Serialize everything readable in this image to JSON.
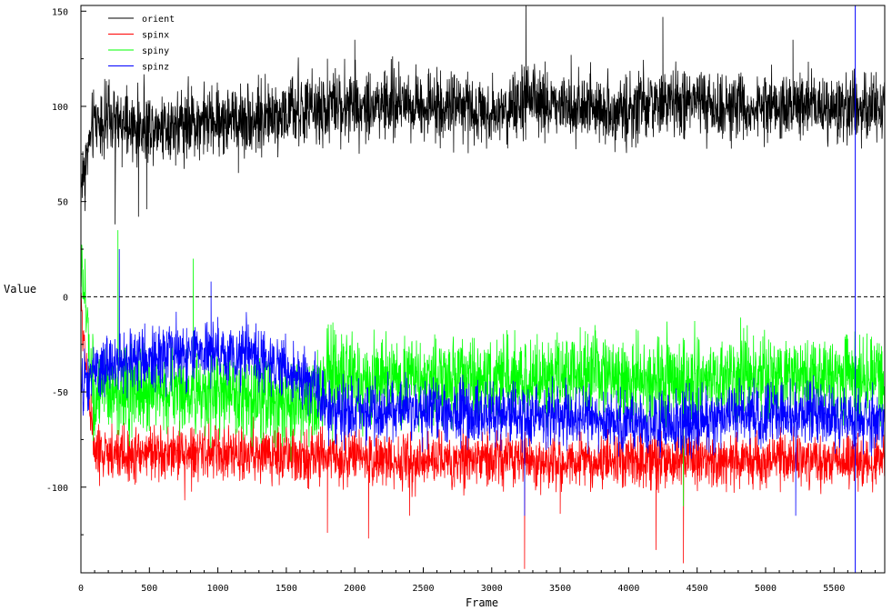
{
  "chart_data": {
    "type": "line",
    "xlabel": "Frame",
    "ylabel": "Value",
    "xlim": [
      0,
      5870
    ],
    "ylim": [
      -145,
      153
    ],
    "x_ticks": [
      0,
      500,
      1000,
      1500,
      2000,
      2500,
      3000,
      3500,
      4000,
      4500,
      5000,
      5500
    ],
    "x_tick_labels": [
      "0",
      "500",
      "1000",
      "1500",
      "2000",
      "2500",
      "3000",
      "3500",
      "4000",
      "4500",
      "5000",
      "5500"
    ],
    "y_ticks": [
      -100,
      -50,
      0,
      50,
      100,
      150
    ],
    "y_tick_labels": [
      "-100",
      "-50",
      "0",
      "50",
      "100",
      "150"
    ],
    "zero_line": {
      "y": 0,
      "style": "dashed"
    },
    "marker_line": {
      "x": 5655,
      "color": "#0000ff"
    },
    "legend": {
      "position": "top-left"
    },
    "grid": false,
    "series": [
      {
        "name": "orient",
        "color": "#000000",
        "x": [
          0,
          100,
          200,
          300,
          400,
          500,
          700,
          900,
          1100,
          1300,
          1500,
          1700,
          1900,
          2100,
          2300,
          2500,
          2700,
          2900,
          3100,
          3300,
          3500,
          3700,
          3900,
          4100,
          4300,
          4500,
          4700,
          4900,
          5100,
          5300,
          5500,
          5700,
          5870
        ],
        "values": [
          60,
          93,
          92,
          90,
          88,
          90,
          91,
          92,
          93,
          94,
          96,
          98,
          100,
          101,
          102,
          101,
          100,
          99,
          98,
          102,
          101,
          100,
          97,
          100,
          102,
          101,
          100,
          99,
          99,
          100,
          99,
          100,
          100
        ],
        "noise": 9,
        "spikes": [
          [
            0,
            42
          ],
          [
            30,
            45
          ],
          [
            250,
            38
          ],
          [
            300,
            68
          ],
          [
            420,
            42
          ],
          [
            480,
            46
          ],
          [
            1150,
            65
          ],
          [
            1800,
            125
          ],
          [
            2000,
            135
          ],
          [
            2100,
            118
          ],
          [
            3250,
            153
          ],
          [
            3580,
            127
          ],
          [
            4250,
            147
          ],
          [
            5200,
            135
          ]
        ]
      },
      {
        "name": "spinx",
        "color": "#ff0000",
        "x": [
          0,
          100,
          300,
          500,
          800,
          1100,
          1400,
          1700,
          2000,
          2300,
          2600,
          2900,
          3200,
          3500,
          3800,
          4100,
          4400,
          4700,
          5000,
          5300,
          5600,
          5870
        ],
        "values": [
          -5,
          -82,
          -83,
          -82,
          -82,
          -82,
          -83,
          -84,
          -84,
          -86,
          -86,
          -85,
          -85,
          -87,
          -86,
          -87,
          -86,
          -86,
          -86,
          -86,
          -86,
          -87
        ],
        "noise": 7,
        "spikes": [
          [
            1800,
            -124
          ],
          [
            2100,
            -127
          ],
          [
            2400,
            -115
          ],
          [
            3240,
            -143
          ],
          [
            3500,
            -114
          ],
          [
            4200,
            -133
          ],
          [
            4400,
            -140
          ]
        ]
      },
      {
        "name": "spiny",
        "color": "#00ff00",
        "x": [
          0,
          100,
          300,
          600,
          900,
          1200,
          1500,
          1700,
          1800,
          2000,
          2300,
          2600,
          2900,
          3200,
          3500,
          3800,
          4100,
          4400,
          4700,
          5000,
          5300,
          5600,
          5870
        ],
        "values": [
          20,
          -55,
          -50,
          -48,
          -50,
          -52,
          -55,
          -60,
          -40,
          -43,
          -44,
          -44,
          -43,
          -43,
          -42,
          -41,
          -44,
          -43,
          -43,
          -42,
          -41,
          -42,
          -43
        ],
        "noise": 11,
        "spikes": [
          [
            270,
            35
          ],
          [
            820,
            20
          ],
          [
            3240,
            -100
          ],
          [
            4400,
            -110
          ]
        ]
      },
      {
        "name": "spinz",
        "color": "#0000ff",
        "x": [
          0,
          100,
          300,
          500,
          700,
          900,
          1100,
          1300,
          1500,
          1700,
          1800,
          2000,
          2300,
          2600,
          2900,
          3200,
          3500,
          3800,
          4100,
          4400,
          4700,
          5000,
          5300,
          5600,
          5870
        ],
        "values": [
          -50,
          -40,
          -35,
          -32,
          -30,
          -30,
          -30,
          -32,
          -38,
          -48,
          -58,
          -60,
          -60,
          -60,
          -61,
          -62,
          -63,
          -64,
          -68,
          -65,
          -63,
          -62,
          -62,
          -64,
          -65
        ],
        "noise": 8,
        "spikes": [
          [
            280,
            25
          ],
          [
            950,
            8
          ],
          [
            3240,
            -115
          ],
          [
            5220,
            -115
          ]
        ]
      }
    ]
  }
}
